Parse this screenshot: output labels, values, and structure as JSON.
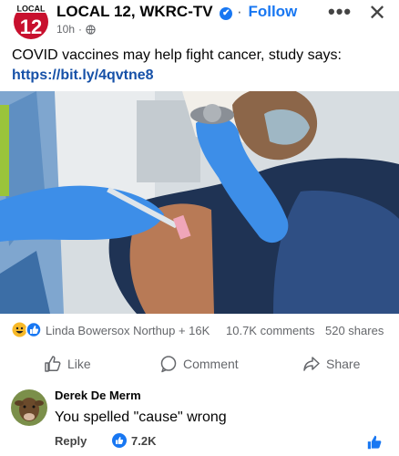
{
  "post": {
    "page_name": "LOCAL 12, WKRC-TV",
    "verified_mark": "✔",
    "separator": "·",
    "follow_label": "Follow",
    "time": "10h",
    "time_separator": "·",
    "logo_text": "LOCAL",
    "logo_number": "12",
    "more_label": "•••",
    "close_label": "✕",
    "caption": "COVID vaccines may help fight cancer, study says:",
    "link": "https://bit.ly/4qvtne8"
  },
  "stats": {
    "reactions_label": "Linda Bowersox Northup + 16K",
    "comments": "10.7K comments",
    "shares": "520 shares"
  },
  "actions": {
    "like": "Like",
    "comment": "Comment",
    "share": "Share"
  },
  "comment": {
    "author": "Derek De Merm",
    "text": "You spelled \"cause\" wrong",
    "reply": "Reply",
    "likes": "7.2K"
  },
  "colors": {
    "brand_blue": "#1877f2",
    "logo_red": "#c8102e",
    "glove_blue": "#3d8ee8"
  }
}
